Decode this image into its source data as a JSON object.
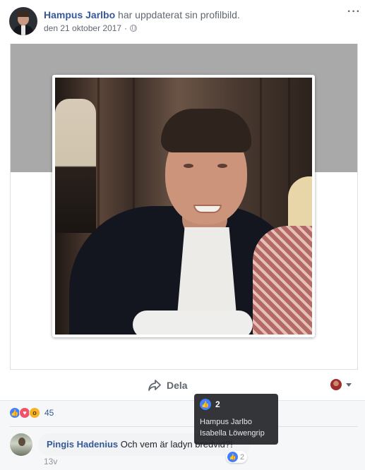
{
  "post": {
    "author": "Hampus Jarlbo",
    "action": "har uppdaterat sin profilbild.",
    "date": "den 21 oktober 2017",
    "separator": "·",
    "more_label": "···",
    "privacy_icon": "globe-icon"
  },
  "actions": {
    "share_label": "Dela",
    "share_icon": "share-arrow-icon",
    "viewer_icon": "caret-down-icon"
  },
  "reactions": {
    "types": [
      "like",
      "love",
      "wow"
    ],
    "count": "45",
    "colors": {
      "like": "#4080ff",
      "love": "#f25268",
      "wow": "#f7b125"
    }
  },
  "comment": {
    "author": "Pingis Hadenius",
    "text": "Och vem är ladyn bredvid?!",
    "time": "13v",
    "like_count": "2"
  },
  "tooltip": {
    "count": "2",
    "names": [
      "Hampus Jarlbo",
      "Isabella Löwengrip"
    ]
  },
  "theme": {
    "link": "#365899",
    "meta": "#616770",
    "cover": "#a9a9a9"
  }
}
